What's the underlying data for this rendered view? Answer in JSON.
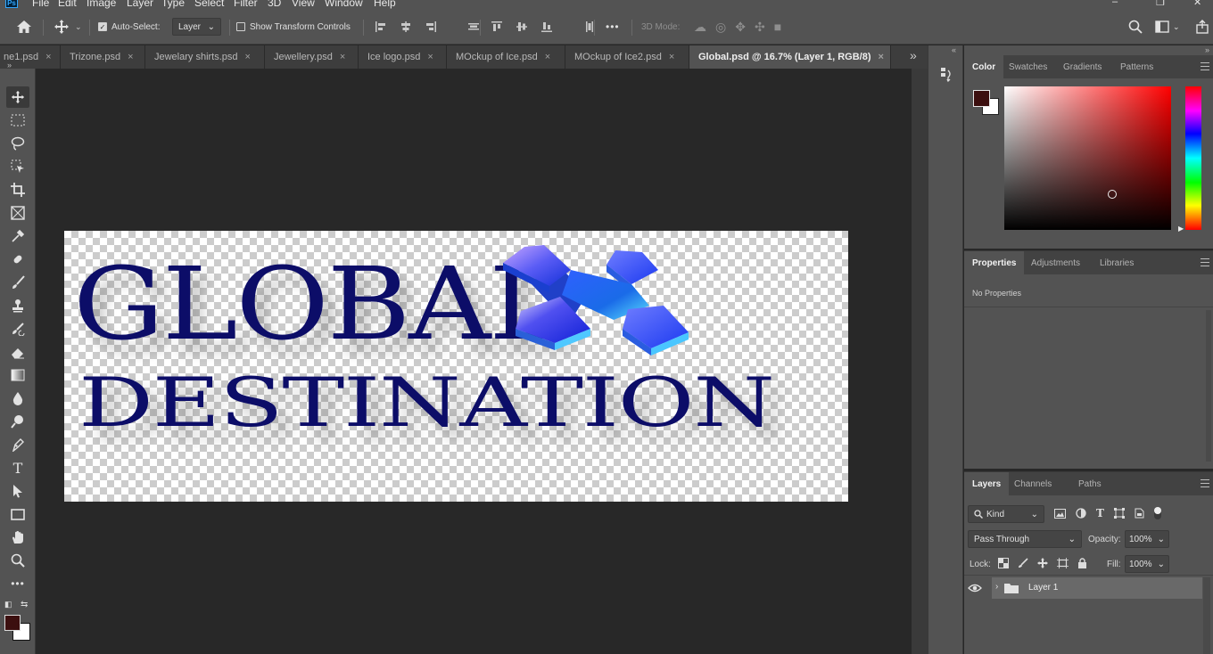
{
  "app": {
    "logo": "Ps"
  },
  "menu": [
    "File",
    "Edit",
    "Image",
    "Layer",
    "Type",
    "Select",
    "Filter",
    "3D",
    "View",
    "Window",
    "Help"
  ],
  "options": {
    "auto_select_label": "Auto-Select:",
    "auto_select_value": "Layer",
    "show_transform_label": "Show Transform Controls",
    "more": "•••",
    "mode_3d_label": "3D Mode:"
  },
  "tabs": [
    {
      "label": "ne1.psd"
    },
    {
      "label": "Trizone.psd"
    },
    {
      "label": "Jewelary shirts.psd"
    },
    {
      "label": "Jewellery.psd"
    },
    {
      "label": "Ice logo.psd"
    },
    {
      "label": "MOckup of Ice.psd"
    },
    {
      "label": "MOckup of Ice2.psd"
    },
    {
      "label": "Global.psd @ 16.7% (Layer 1, RGB/8)"
    }
  ],
  "tab_close": "×",
  "tab_overflow": "»",
  "artwork": {
    "line1": "GLOBAL",
    "line2": "DESTINATION"
  },
  "panels": {
    "color_tabs": [
      "Color",
      "Swatches",
      "Gradients",
      "Patterns"
    ],
    "properties_tabs": [
      "Properties",
      "Adjustments",
      "Libraries"
    ],
    "properties_empty": "No Properties",
    "layers_tabs": [
      "Layers",
      "Channels",
      "Paths"
    ]
  },
  "colors": {
    "foreground": "#3c0f0f",
    "background": "#ffffff",
    "picker_hue": "#ff0000",
    "accent_text": "#0c0d68"
  },
  "layers": {
    "filter_kind": "Kind",
    "blend_mode": "Pass Through",
    "opacity_label": "Opacity:",
    "opacity_value": "100%",
    "lock_label": "Lock:",
    "fill_label": "Fill:",
    "fill_value": "100%",
    "items": [
      {
        "name": "Layer 1",
        "type": "group",
        "visible": true
      }
    ]
  }
}
